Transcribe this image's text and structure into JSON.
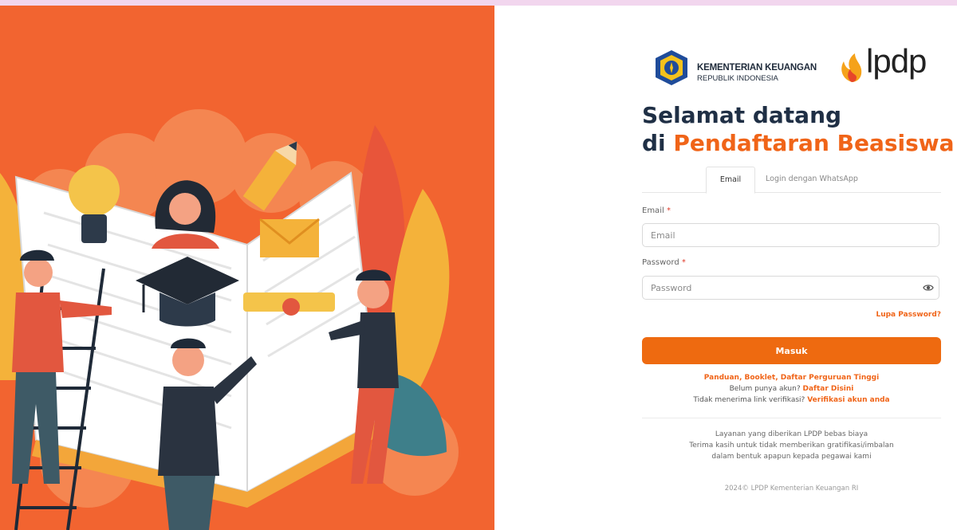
{
  "brand": {
    "ministry_line1": "KEMENTERIAN KEUANGAN",
    "ministry_line2": "REPUBLIK INDONESIA",
    "lpdp_logo_text": "lpdp"
  },
  "heading": {
    "line1": "Selamat datang",
    "line2_prefix": "di ",
    "line2_accent": "Pendaftaran Beasiswa"
  },
  "tabs": [
    {
      "label": "Email",
      "active": true
    },
    {
      "label": "Login dengan WhatsApp",
      "active": false
    }
  ],
  "form": {
    "email_label": "Email",
    "email_placeholder": "Email",
    "email_value": "",
    "password_label": "Password",
    "password_placeholder": "Password",
    "password_value": "",
    "required_mark": "*",
    "forgot_password": "Lupa Password?",
    "submit_label": "Masuk"
  },
  "links": {
    "guides": "Panduan, Booklet, Daftar Perguruan Tinggi",
    "no_account_text": "Belum punya akun?",
    "register_link": "Daftar Disini",
    "no_verification_text": "Tidak menerima link verifikasi?",
    "verify_link": "Verifikasi akun anda"
  },
  "notice": {
    "line1": "Layanan yang diberikan LPDP bebas biaya",
    "line2": "Terima kasih untuk tidak memberikan gratifikasi/imbalan",
    "line3": "dalam bentuk apapun kepada pegawai kami"
  },
  "footer": {
    "copyright": "2024© LPDP Kementerian Keuangan RI"
  },
  "icons": {
    "ministry_logo": "ministry-emblem-icon",
    "lpdp_logo": "lpdp-flame-icon",
    "password_toggle": "eye-icon"
  },
  "colors": {
    "illustration_bg": "#f26430",
    "accent": "#f06418",
    "button": "#ee6a10",
    "heading": "#1f2f45"
  }
}
